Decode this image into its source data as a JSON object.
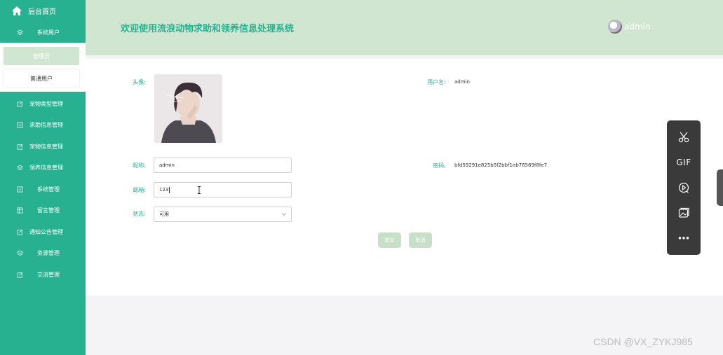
{
  "sidebar": {
    "home_label": "后台首页",
    "system_user_label": "系统用户",
    "sub_items": [
      "管理员",
      "普通用户"
    ],
    "menu": [
      {
        "label": "宠物类型管理",
        "icon": "edit-icon"
      },
      {
        "label": "求助信息管理",
        "icon": "check-square-icon"
      },
      {
        "label": "宠物信息管理",
        "icon": "edit-icon"
      },
      {
        "label": "领养信息管理",
        "icon": "layers-icon"
      },
      {
        "label": "系统管理",
        "icon": "check-square-icon"
      },
      {
        "label": "留言管理",
        "icon": "table-icon"
      },
      {
        "label": "通知公告管理",
        "icon": "edit-icon"
      },
      {
        "label": "资源管理",
        "icon": "layers-icon"
      },
      {
        "label": "交流管理",
        "icon": "edit-icon"
      }
    ]
  },
  "header": {
    "title": "欢迎使用流浪动物求助和领养信息处理系统",
    "username": "admin"
  },
  "form": {
    "avatar_label": "头像:",
    "username_label": "用户名:",
    "username_value": "admin",
    "nickname_label": "昵称:",
    "nickname_value": "admin",
    "password_label": "密码:",
    "password_value": "bfd59291e825b5f2bbf1eb76569f8fe7",
    "email_label": "邮箱:",
    "email_value": "123",
    "status_label": "状态:",
    "status_value": "可用",
    "submit_label": "提交",
    "cancel_label": "取消"
  },
  "toolbar": {
    "gif_label": "GIF",
    "items": [
      "scissors-icon",
      "gif-icon",
      "play-circle-icon",
      "image-icon",
      "more-icon"
    ]
  },
  "watermark": "CSDN @VX_ZYKJ985",
  "colors": {
    "sidebar_bg": "#27b190",
    "header_bg": "#d1e6d1",
    "accent": "#27b190",
    "button_bg": "#c8e0c8"
  }
}
